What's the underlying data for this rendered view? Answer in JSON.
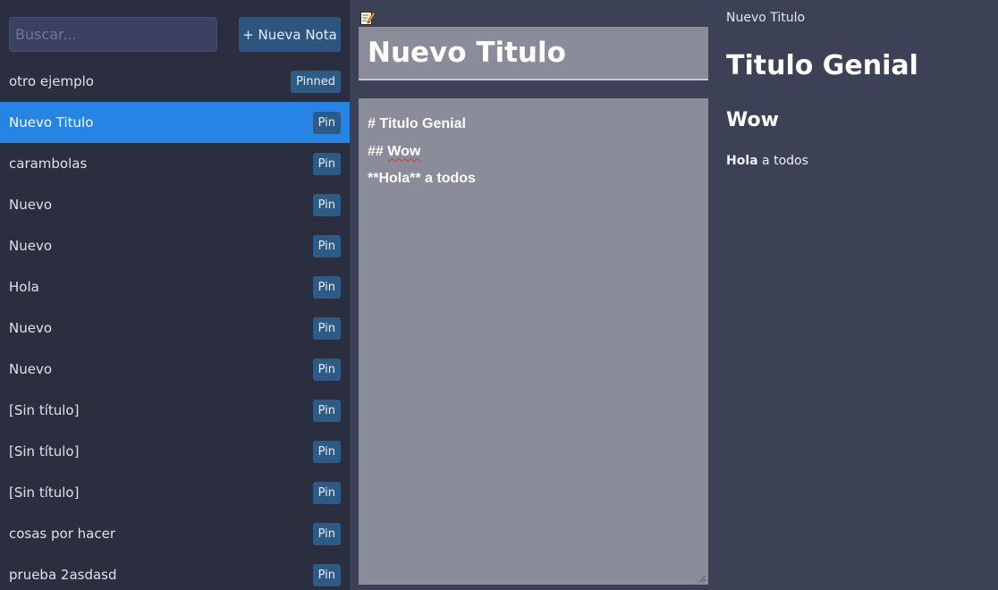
{
  "sidebar": {
    "search_placeholder": "Buscar...",
    "new_note_label": "+ Nueva Nota",
    "notes": [
      {
        "title": "otro ejemplo",
        "pin_label": "Pinned",
        "active": false
      },
      {
        "title": "Nuevo Titulo",
        "pin_label": "Pin",
        "active": true
      },
      {
        "title": "carambolas",
        "pin_label": "Pin",
        "active": false
      },
      {
        "title": "Nuevo",
        "pin_label": "Pin",
        "active": false
      },
      {
        "title": "Nuevo",
        "pin_label": "Pin",
        "active": false
      },
      {
        "title": "Hola",
        "pin_label": "Pin",
        "active": false
      },
      {
        "title": "Nuevo",
        "pin_label": "Pin",
        "active": false
      },
      {
        "title": "Nuevo",
        "pin_label": "Pin",
        "active": false
      },
      {
        "title": "[Sin título]",
        "pin_label": "Pin",
        "active": false
      },
      {
        "title": "[Sin título]",
        "pin_label": "Pin",
        "active": false
      },
      {
        "title": "[Sin título]",
        "pin_label": "Pin",
        "active": false
      },
      {
        "title": "cosas por hacer",
        "pin_label": "Pin",
        "active": false
      },
      {
        "title": "prueba 2asdasd",
        "pin_label": "Pin",
        "active": false
      }
    ]
  },
  "editor": {
    "title_value": "Nuevo Titulo",
    "lines": {
      "l1": "# Titulo Genial",
      "l2_prefix": "## ",
      "l2_word": "Wow",
      "l3": "**Hola** a todos"
    }
  },
  "preview": {
    "note_title": "Nuevo Titulo",
    "h1": "Titulo Genial",
    "h2": "Wow",
    "p_bold": "Hola",
    "p_rest": " a todos"
  },
  "colors": {
    "active_item": "#2584e4",
    "pin_button": "#2d5b88",
    "editor_bg": "#8a8c99"
  },
  "icons": {
    "edit": "notepad-pencil-icon"
  }
}
